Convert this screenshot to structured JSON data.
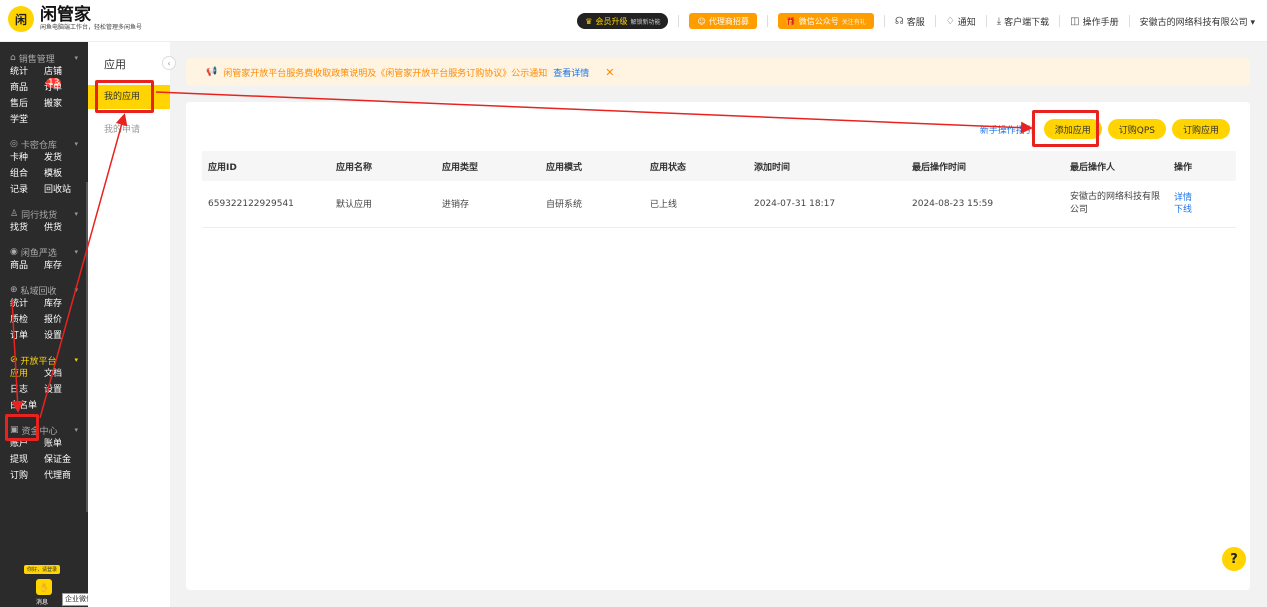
{
  "header": {
    "logo_mark": "闲",
    "brand": "闲管家",
    "tagline": "闲鱼电脑端工作台，轻松管理多闲鱼号",
    "vip": {
      "label": "会员升级",
      "sub": "解锁新功能"
    },
    "agent": {
      "label": "代理商招募"
    },
    "wechat": {
      "label": "微信公众号",
      "sub": "关注有礼"
    },
    "nav": [
      {
        "label": "客服",
        "icon": "headset-icon"
      },
      {
        "label": "通知",
        "icon": "bell-icon"
      },
      {
        "label": "客户端下载",
        "icon": "download-icon"
      },
      {
        "label": "操作手册",
        "icon": "book-icon"
      }
    ],
    "company": "安徽古的网络科技有限公司 ▾"
  },
  "sidebar": {
    "groups": [
      {
        "title": "销售管理",
        "links": [
          "统计",
          "店铺",
          "商品",
          "订单",
          "售后",
          "搬家",
          "学堂"
        ],
        "badge": "13"
      },
      {
        "title": "卡密仓库",
        "links": [
          "卡种",
          "发货",
          "组合",
          "模板",
          "记录",
          "回收站"
        ]
      },
      {
        "title": "同行找货",
        "links": [
          "找货",
          "供货"
        ]
      },
      {
        "title": "闲鱼严选",
        "links": [
          "商品",
          "库存"
        ]
      },
      {
        "title": "私域回收",
        "links": [
          "统计",
          "库存",
          "质检",
          "报价",
          "订单",
          "设置"
        ]
      },
      {
        "title": "开放平台",
        "links": [
          "应用",
          "文档",
          "日志",
          "设置",
          "白名单"
        ]
      },
      {
        "title": "资金中心",
        "links": [
          "账户",
          "账单",
          "提现",
          "保证金",
          "订购",
          "代理商"
        ]
      }
    ],
    "hello": "你好，请登录",
    "message": "消息",
    "tooltip": "企业微信"
  },
  "sub_sidebar": {
    "title": "应用",
    "items": [
      "我的应用",
      "我的申请"
    ]
  },
  "notice": {
    "text": "闲管家开放平台服务费收取政策说明及《闲管家开放平台服务订购协议》公示通知",
    "link": "查看详情"
  },
  "actions": {
    "guide": "新手操作指引",
    "add": "添加应用",
    "qps": "订购QPS",
    "buy": "订购应用"
  },
  "table": {
    "headers": [
      "应用ID",
      "应用名称",
      "应用类型",
      "应用模式",
      "应用状态",
      "添加时间",
      "最后操作时间",
      "最后操作人",
      "操作"
    ],
    "rows": [
      {
        "id": "659322122929541",
        "name": "默认应用",
        "type": "进销存",
        "mode": "自研系统",
        "status": "已上线",
        "added": "2024-07-31 18:17",
        "last_time": "2024-08-23 15:59",
        "last_user": "安徽古的网络科技有限公司",
        "ops": [
          "详情",
          "下线"
        ]
      }
    ]
  },
  "help": "?",
  "colors": {
    "accent": "#ffd400",
    "sidebar_bg": "#2b2b2b",
    "link": "#1a73e8",
    "highlight": "#e8231f"
  }
}
